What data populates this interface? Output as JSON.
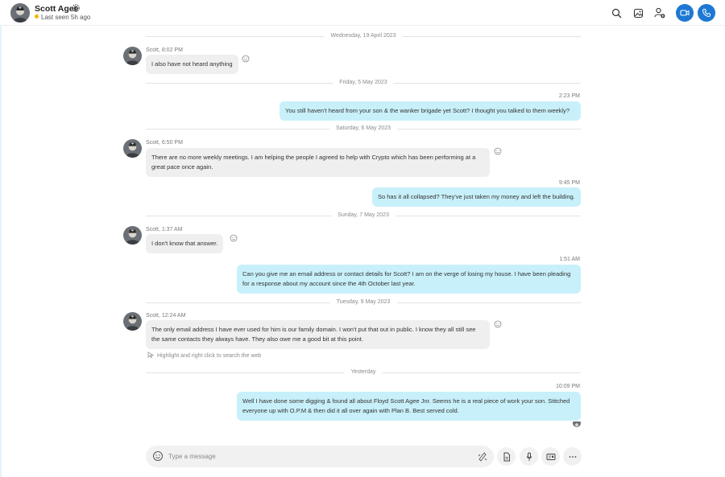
{
  "header": {
    "contact_name": "Scott Agee",
    "status": "Last seen 5h ago",
    "status_color": "#f8b400",
    "accent_color": "#1d78d3",
    "icons": [
      "search-icon",
      "gallery-icon",
      "add-person-icon",
      "video-call-icon",
      "audio-call-icon",
      "gear-icon"
    ]
  },
  "conversation": {
    "days": [
      "Wednesday, 19 April 2023",
      "Friday, 5 May 2023",
      "Saturday, 6 May 2023",
      "Sunday, 7 May 2023",
      "Tuesday, 9 May 2023",
      "Yesterday"
    ],
    "messages": [
      {
        "direction": "in",
        "meta": "Scott, 8:02 PM",
        "text": "I also have not heard anything"
      },
      {
        "direction": "out",
        "meta": "2:23 PM",
        "text": "You still haven't heard from your son & the wanker brigade yet Scott? I thought you talked to them weekly?"
      },
      {
        "direction": "in",
        "meta": "Scott, 6:50 PM",
        "text": "There are no more weekly meetings. I am helping the people I agreed to help with Crypto which has been performing at a great pace once again."
      },
      {
        "direction": "out",
        "meta": "9:45 PM",
        "text": "So has it all collapsed? They've just taken my money and left the building."
      },
      {
        "direction": "in",
        "meta": "Scott, 1:37 AM",
        "text": "I don't know that answer."
      },
      {
        "direction": "out",
        "meta": "1:51 AM",
        "text": "Can you give me an email address or contact details for Scott? I am on the verge of losing my house. I have been pleading for a response about my account since the 4th October last year."
      },
      {
        "direction": "in",
        "meta": "Scott, 12:24 AM",
        "text": "The only email address I have ever used for him is our family domain. I won't put that out in public. I know they all still see the same contacts they always have. They also owe me a good bit at this point."
      },
      {
        "direction": "out",
        "meta": "10:09 PM",
        "text": "Well I have done some digging & found all about Floyd Scott Agee Jnr. Seems he is a real piece of work your son. Stitched everyone up with O.P.M & then did it all over again with Plan B.  Best served cold."
      }
    ],
    "hint": "Highlight and right click to search the web",
    "incoming_bubble_color": "#efefef",
    "outgoing_bubble_color": "#c8f0fa"
  },
  "composer": {
    "placeholder": "Type a message",
    "icons": [
      "emoji-icon",
      "format-icon",
      "attach-file-icon",
      "microphone-icon",
      "contact-card-icon",
      "more-icon"
    ]
  }
}
